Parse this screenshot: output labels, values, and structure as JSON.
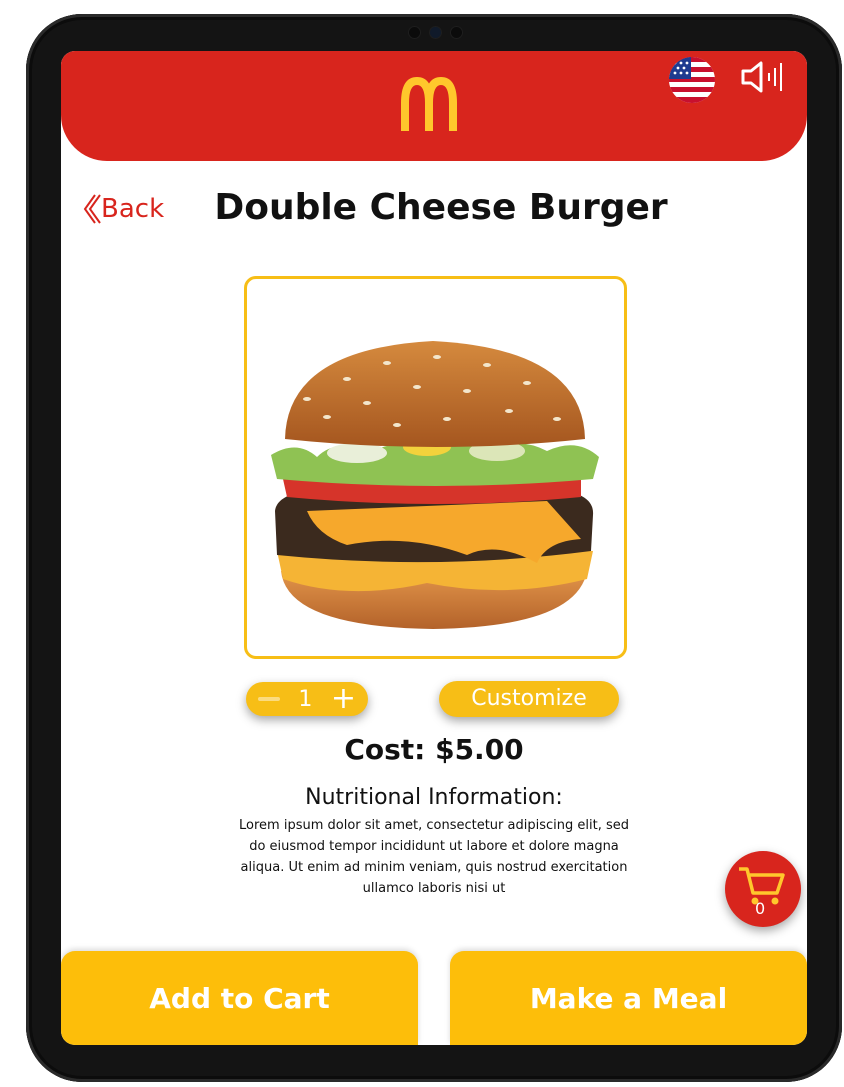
{
  "header": {
    "logo_icon": "mcdonalds-arches-icon",
    "flag_icon": "us-flag-icon",
    "sound_icon": "speaker-icon",
    "brand_red": "#d8251d",
    "accent_yellow": "#f7be16"
  },
  "nav": {
    "back_label": "Back",
    "back_icon": "chevron-left-icon"
  },
  "product": {
    "title": "Double Cheese Burger",
    "image_icon": "burger-image",
    "quantity": "1",
    "minus_label": "−",
    "plus_label": "+",
    "customize_label": "Customize",
    "cost_label": "Cost: $5.00",
    "nutrition_title": "Nutritional Information:",
    "nutrition_text": "Lorem ipsum dolor sit amet, consectetur adipiscing elit, sed do eiusmod tempor incididunt ut labore et dolore magna aliqua. Ut enim ad minim veniam, quis nostrud exercitation ullamco laboris nisi ut"
  },
  "cart": {
    "icon": "shopping-cart-icon",
    "count": "0"
  },
  "actions": {
    "add_to_cart": "Add to Cart",
    "make_meal": "Make a Meal"
  }
}
